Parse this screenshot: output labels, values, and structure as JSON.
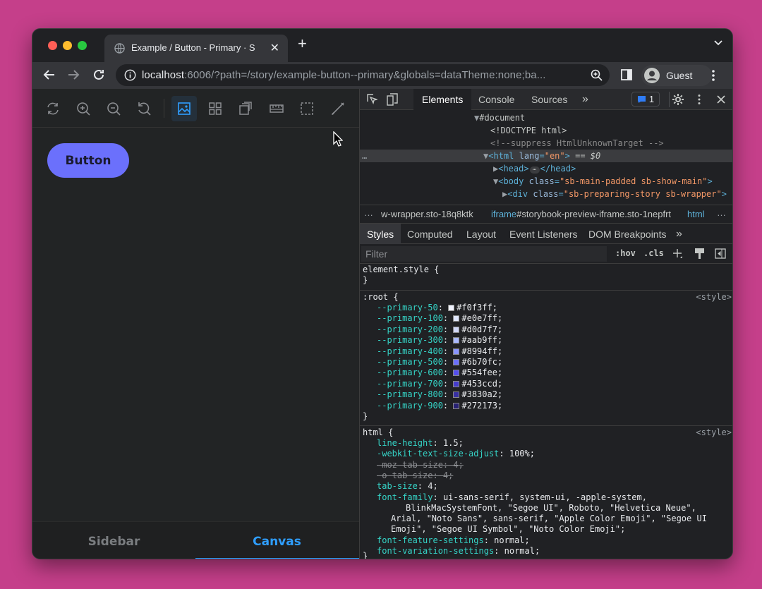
{
  "browser": {
    "tab_title": "Example / Button - Primary · S",
    "url_host": "localhost",
    "url_rest": ":6006/?path=/story/example-button--primary&globals=dataTheme:none;ba...",
    "profile_label": "Guest"
  },
  "storybook": {
    "tools": [
      "reload-icon",
      "zoom-in-icon",
      "zoom-out-icon",
      "zoom-reset-icon",
      "background-icon",
      "grid-icon",
      "viewport-icon",
      "ruler-icon",
      "outline-icon",
      "brush-icon"
    ],
    "button_label": "Button",
    "bottom_tabs": [
      "Sidebar",
      "Canvas"
    ],
    "active_bottom_tab": "Canvas"
  },
  "devtools": {
    "tabs": [
      "Elements",
      "Console",
      "Sources"
    ],
    "active_tab": "Elements",
    "badge_count": "1",
    "dom": {
      "document": "#document",
      "doctype": "<!DOCTYPE html>",
      "comment": "<!--suppress HtmlUnknownTarget -->",
      "html_tag": "<html",
      "html_attr": "lang",
      "html_val": "\"en\"",
      "html_end": ">",
      "selected_marker": "== $0",
      "head_open": "<head>",
      "head_close": "</head>",
      "body_tag": "<body",
      "body_attr": "class",
      "body_val": "\"sb-main-padded sb-show-main\"",
      "div_tag": "<div",
      "div_attr": "class",
      "div_val": "\"sb-preparing-story sb-wrapper\""
    },
    "breadcrumbs": {
      "crumb1": "w-wrapper.sto-18q8ktk",
      "crumb2_kw": "iframe",
      "crumb2_rest": "#storybook-preview-iframe.sto-1nepfrt",
      "crumb3": "html"
    },
    "style_tabs": [
      "Styles",
      "Computed",
      "Layout",
      "Event Listeners",
      "DOM Breakpoints"
    ],
    "active_style_tab": "Styles",
    "filter_placeholder": "Filter",
    "hov_label": ":hov",
    "cls_label": ".cls",
    "element_style_selector": "element.style {",
    "close_brace": "}",
    "root_selector": ":root {",
    "source_label": "<style>",
    "root_vars": [
      {
        "name": "--primary-50",
        "value": "#f0f3ff"
      },
      {
        "name": "--primary-100",
        "value": "#e0e7ff"
      },
      {
        "name": "--primary-200",
        "value": "#d0d7f7"
      },
      {
        "name": "--primary-300",
        "value": "#aab9ff"
      },
      {
        "name": "--primary-400",
        "value": "#8994ff"
      },
      {
        "name": "--primary-500",
        "value": "#6b70fc"
      },
      {
        "name": "--primary-600",
        "value": "#554fee"
      },
      {
        "name": "--primary-700",
        "value": "#453ccd"
      },
      {
        "name": "--primary-800",
        "value": "#3830a2"
      },
      {
        "name": "--primary-900",
        "value": "#272173"
      }
    ],
    "html_selector": "html {",
    "html_props": [
      {
        "name": "line-height",
        "value": "1.5;"
      },
      {
        "name": "-webkit-text-size-adjust",
        "value": "100%;"
      },
      {
        "name": "-moz-tab-size",
        "value": "4;"
      },
      {
        "name": "-o-tab-size",
        "value": "4;"
      },
      {
        "name": "tab-size",
        "value": "4;"
      },
      {
        "name": "font-family",
        "value": "ui-sans-serif, system-ui, -apple-system,"
      }
    ],
    "font_family_cont": [
      "BlinkMacSystemFont, \"Segoe UI\", Roboto, \"Helvetica Neue\",",
      "Arial, \"Noto Sans\", sans-serif, \"Apple Color Emoji\", \"Segoe UI",
      "Emoji\", \"Segoe UI Symbol\", \"Noto Color Emoji\";"
    ],
    "html_props2": [
      {
        "name": "font-feature-settings",
        "value": "normal;"
      },
      {
        "name": "font-variation-settings",
        "value": "normal;"
      }
    ]
  }
}
